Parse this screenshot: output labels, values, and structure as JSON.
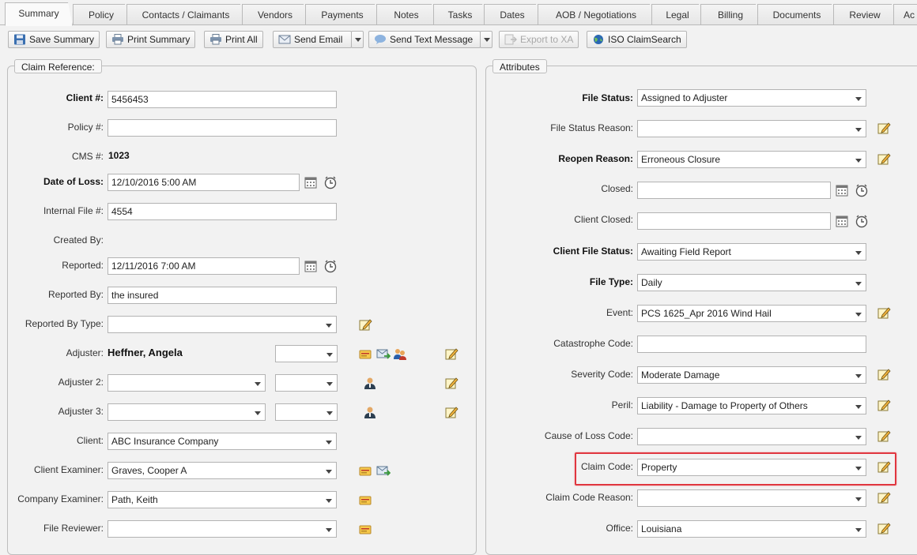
{
  "tabs": [
    "Summary",
    "Policy",
    "Contacts / Claimants",
    "Vendors",
    "Payments",
    "Notes",
    "Tasks",
    "Dates",
    "AOB / Negotiations",
    "Legal",
    "Billing",
    "Documents",
    "Review",
    "Ac"
  ],
  "toolbar": {
    "save_summary": "Save Summary",
    "print_summary": "Print Summary",
    "print_all": "Print All",
    "send_email": "Send Email",
    "send_text": "Send Text Message",
    "export_xa": "Export to XA",
    "iso_claimsearch": "ISO ClaimSearch"
  },
  "claim_reference": {
    "legend": "Claim Reference:",
    "client_no_label": "Client #:",
    "client_no_value": "5456453",
    "policy_no_label": "Policy #:",
    "policy_no_value": "",
    "cms_label": "CMS #:",
    "cms_value": "1023",
    "date_of_loss_label": "Date of Loss:",
    "date_of_loss_value": "12/10/2016 5:00 AM",
    "internal_file_label": "Internal File #:",
    "internal_file_value": "4554",
    "created_by_label": "Created By:",
    "reported_label": "Reported:",
    "reported_value": "12/11/2016 7:00 AM",
    "reported_by_label": "Reported By:",
    "reported_by_value": "the insured",
    "reported_by_type_label": "Reported By Type:",
    "reported_by_type_value": "",
    "adjuster_label": "Adjuster:",
    "adjuster_value": "Heffner, Angela",
    "adjuster2_label": "Adjuster 2:",
    "adjuster3_label": "Adjuster 3:",
    "client_label": "Client:",
    "client_value": "ABC Insurance Company",
    "client_examiner_label": "Client Examiner:",
    "client_examiner_value": "Graves, Cooper A",
    "company_examiner_label": "Company Examiner:",
    "company_examiner_value": "Path, Keith",
    "file_reviewer_label": "File Reviewer:",
    "file_reviewer_value": ""
  },
  "attributes": {
    "legend": "Attributes",
    "file_status_label": "File Status:",
    "file_status_value": "Assigned to Adjuster",
    "file_status_reason_label": "File Status Reason:",
    "file_status_reason_value": "",
    "reopen_reason_label": "Reopen Reason:",
    "reopen_reason_value": "Erroneous Closure",
    "closed_label": "Closed:",
    "closed_value": "",
    "client_closed_label": "Client Closed:",
    "client_closed_value": "",
    "client_file_status_label": "Client File Status:",
    "client_file_status_value": "Awaiting Field Report",
    "file_type_label": "File Type:",
    "file_type_value": "Daily",
    "event_label": "Event:",
    "event_value": "PCS 1625_Apr 2016 Wind Hail",
    "catastrophe_code_label": "Catastrophe Code:",
    "catastrophe_code_value": "",
    "severity_code_label": "Severity Code:",
    "severity_code_value": "Moderate Damage",
    "peril_label": "Peril:",
    "peril_value": "Liability - Damage to Property of Others",
    "cause_of_loss_label": "Cause of Loss Code:",
    "cause_of_loss_value": "",
    "claim_code_label": "Claim Code:",
    "claim_code_value": "Property",
    "claim_code_reason_label": "Claim Code Reason:",
    "claim_code_reason_value": "",
    "office_label": "Office:",
    "office_value": "Louisiana"
  },
  "colors": {
    "highlight": "#e0363f",
    "background": "#f2f2f2"
  },
  "icons": [
    "save-icon",
    "printer-icon",
    "envelope-icon",
    "sms-icon",
    "export-icon",
    "globe-icon",
    "calendar-icon",
    "clock-icon",
    "edit-note-icon",
    "contact-card-icon",
    "email-forward-icon",
    "user-group-icon",
    "user-icon"
  ]
}
